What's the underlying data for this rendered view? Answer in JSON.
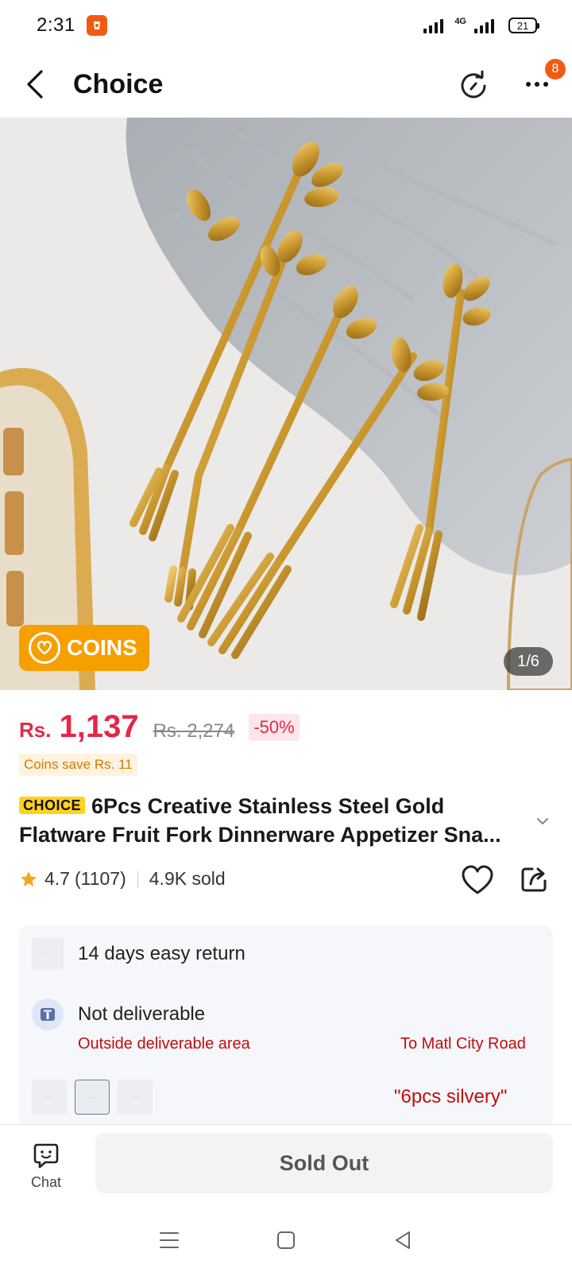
{
  "status_bar": {
    "time": "2:31",
    "network": "4G",
    "battery": "21"
  },
  "header": {
    "title": "Choice",
    "badge_count": "8"
  },
  "gallery": {
    "coins_label": "COINS",
    "counter": "1/6"
  },
  "price": {
    "currency": "Rs.",
    "current": "1,137",
    "original": "Rs. 2,274",
    "discount": "-50%",
    "coins_save": "Coins save Rs. 11"
  },
  "product": {
    "badge": "CHOICE",
    "title": "6Pcs Creative Stainless Steel Gold Flatware Fruit Fork Dinnerware Appetizer Sna...",
    "rating": "4.7",
    "reviews": "(1107)",
    "sold": "4.9K sold"
  },
  "info": {
    "return_policy": "14 days easy return",
    "delivery_status": "Not deliverable",
    "delivery_warning": "Outside deliverable area",
    "delivery_destination": "To Matl City Road",
    "selected_variant": "\"6pcs silvery\""
  },
  "bottom_bar": {
    "chat_label": "Chat",
    "sold_out_label": "Sold Out"
  },
  "icons": [
    "back-icon",
    "history-icon",
    "more-icon",
    "coin-icon",
    "star-icon",
    "heart-icon",
    "share-icon",
    "info-icon",
    "chat-icon",
    "menu-icon",
    "home-icon",
    "back-nav-icon"
  ],
  "colors": {
    "brand": "#f25a14",
    "price": "#e4274a",
    "coins": "#f5a000",
    "warning": "#c40c0c",
    "choice_tag": "#ffd21f"
  }
}
